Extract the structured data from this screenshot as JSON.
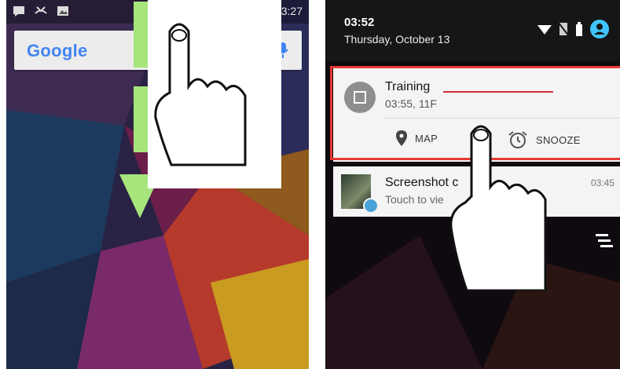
{
  "left_screen": {
    "status_time": "03:27",
    "search_logo": "Google",
    "icons": [
      "message-icon",
      "missed-call-icon",
      "image-icon",
      "wifi-icon",
      "sim-icon",
      "battery-icon",
      "mic-icon"
    ]
  },
  "right_screen": {
    "time": "03:52",
    "date": "Thursday, October 13",
    "icons": [
      "wifi-icon",
      "no-sim-icon",
      "battery-icon",
      "account-icon"
    ],
    "notifications": [
      {
        "title": "Training",
        "subtitle": "03:55, 11F",
        "actions": [
          {
            "label": "MAP",
            "icon": "location-pin-icon"
          },
          {
            "label": "SNOOZE",
            "icon": "alarm-icon"
          }
        ]
      },
      {
        "title": "Screenshot c",
        "subtitle": "Touch to vie",
        "time": "03:45"
      }
    ]
  },
  "colors": {
    "highlight_border": "#e53935",
    "arrow_green": "#a5e57c",
    "google_blue": "#4285f4"
  }
}
